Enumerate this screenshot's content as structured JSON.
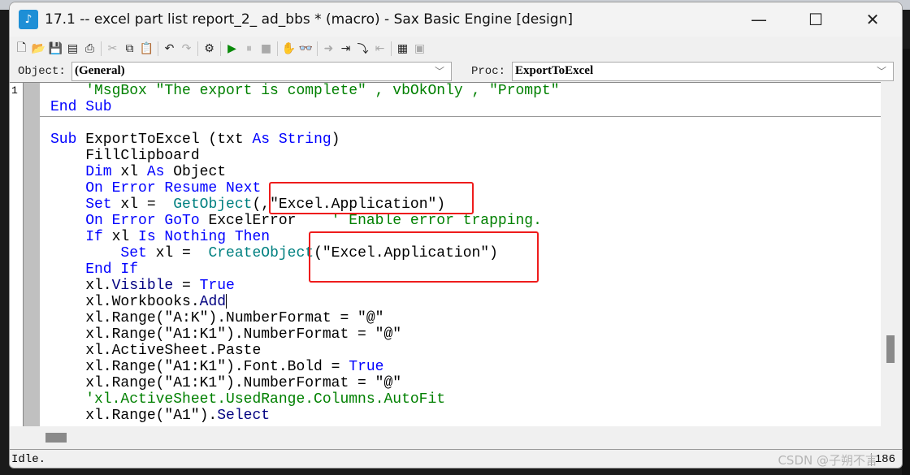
{
  "window": {
    "title": "17.1 -- excel part list report_2_ ad_bbs * (macro) - Sax Basic Engine [design]",
    "app_icon": "sax-basic-icon"
  },
  "controls": {
    "minimize": "—",
    "maximize": "☐",
    "close": "✕"
  },
  "toolbar": [
    {
      "name": "new-icon",
      "g": "🗋",
      "d": false
    },
    {
      "name": "open-icon",
      "g": "📂",
      "d": false
    },
    {
      "name": "save-icon",
      "g": "💾",
      "d": false
    },
    {
      "name": "save-all-icon",
      "g": "▤",
      "d": false
    },
    {
      "name": "print-icon",
      "g": "⎙",
      "d": false
    },
    {
      "sep": true
    },
    {
      "name": "cut-icon",
      "g": "✂",
      "d": true
    },
    {
      "name": "copy-icon",
      "g": "⧉",
      "d": false
    },
    {
      "name": "paste-icon",
      "g": "📋",
      "d": false
    },
    {
      "sep": true
    },
    {
      "name": "undo-icon",
      "g": "↶",
      "d": false
    },
    {
      "name": "redo-icon",
      "g": "↷",
      "d": true
    },
    {
      "sep": true
    },
    {
      "name": "references-icon",
      "g": "⚙",
      "d": false
    },
    {
      "sep": true
    },
    {
      "name": "run-icon",
      "g": "▶",
      "d": false,
      "c": "#0a8a0a"
    },
    {
      "name": "pause-icon",
      "g": "⏸",
      "d": true
    },
    {
      "name": "stop-icon",
      "g": "■",
      "d": true
    },
    {
      "sep": true
    },
    {
      "name": "breakpoint-hand-icon",
      "g": "✋",
      "d": false
    },
    {
      "name": "quick-watch-icon",
      "g": "👓",
      "d": false
    },
    {
      "sep": true
    },
    {
      "name": "step-icon",
      "g": "➜",
      "d": true
    },
    {
      "name": "step-into-icon",
      "g": "⇥",
      "d": false
    },
    {
      "name": "step-over-icon",
      "g": "⤵",
      "d": false
    },
    {
      "name": "step-out-icon",
      "g": "⇤",
      "d": true
    },
    {
      "sep": true
    },
    {
      "name": "dialog-editor-icon",
      "g": "▦",
      "d": false
    },
    {
      "name": "properties-icon",
      "g": "▣",
      "d": true
    }
  ],
  "object": {
    "label": "Object:",
    "value": "(General)"
  },
  "proc": {
    "label": "Proc:",
    "value": "ExportToExcel"
  },
  "gutter": {
    "line_number": "1"
  },
  "code": {
    "lines": [
      [
        [
          "    'MsgBox \"The export is complete\" , vbOkOnly , \"Prompt\"",
          "cm"
        ]
      ],
      [
        [
          "End Sub",
          "kw"
        ]
      ],
      [],
      [
        [
          "Sub",
          "kw"
        ],
        [
          " ExportToExcel (txt ",
          "pl"
        ],
        [
          "As String",
          "kw"
        ],
        [
          ")",
          "pl"
        ]
      ],
      [
        [
          "    FillClipboard",
          "pl"
        ]
      ],
      [
        [
          "    Dim",
          "kw"
        ],
        [
          " xl ",
          "pl"
        ],
        [
          "As",
          "kw"
        ],
        [
          " Object",
          "pl"
        ]
      ],
      [
        [
          "    On Error Resume Next",
          "kw"
        ]
      ],
      [
        [
          "    Set",
          "kw"
        ],
        [
          " xl =  ",
          "pl"
        ],
        [
          "GetObject",
          "fn"
        ],
        [
          "(,\"Excel.Application\")",
          "pl"
        ]
      ],
      [
        [
          "    On Error GoTo",
          "kw"
        ],
        [
          " ExcelError    ",
          "pl"
        ],
        [
          "' Enable error trapping.",
          "cm"
        ]
      ],
      [
        [
          "    If",
          "kw"
        ],
        [
          " xl ",
          "pl"
        ],
        [
          "Is Nothing Then",
          "kw"
        ]
      ],
      [
        [
          "        Set",
          "kw"
        ],
        [
          " xl =  ",
          "pl"
        ],
        [
          "CreateObject",
          "fn"
        ],
        [
          "(\"Excel.Application\")",
          "pl"
        ]
      ],
      [
        [
          "    End If",
          "kw"
        ]
      ],
      [
        [
          "    xl.",
          "pl"
        ],
        [
          "Visible",
          "mt"
        ],
        [
          " = ",
          "pl"
        ],
        [
          "True",
          "kw"
        ]
      ],
      [
        [
          "    xl.Workbooks.",
          "pl"
        ],
        [
          "Add",
          "mt"
        ],
        [
          "|",
          "caret"
        ]
      ],
      [
        [
          "    xl.Range(\"A:K\").NumberFormat = \"@\"",
          "pl"
        ]
      ],
      [
        [
          "    xl.Range(\"A1:K1\").NumberFormat = \"@\"",
          "pl"
        ]
      ],
      [
        [
          "    xl.ActiveSheet.Paste",
          "pl"
        ]
      ],
      [
        [
          "    xl.Range(\"A1:K1\").Font.Bold = ",
          "pl"
        ],
        [
          "True",
          "kw"
        ]
      ],
      [
        [
          "    xl.Range(\"A1:K1\").NumberFormat = \"@\"",
          "pl"
        ]
      ],
      [
        [
          "    'xl.ActiveSheet.UsedRange.Columns.AutoFit",
          "cm"
        ]
      ],
      [
        [
          "    xl.Range(\"A1\").",
          "pl"
        ],
        [
          "Select",
          "mt"
        ]
      ]
    ]
  },
  "status": {
    "text": "Idle.",
    "position": "186"
  },
  "watermark": "CSDN @子朔不言",
  "colors": {
    "keyword": "#0000ff",
    "comment": "#008000",
    "function": "#008080",
    "highlight_box": "#ee1c1c"
  }
}
